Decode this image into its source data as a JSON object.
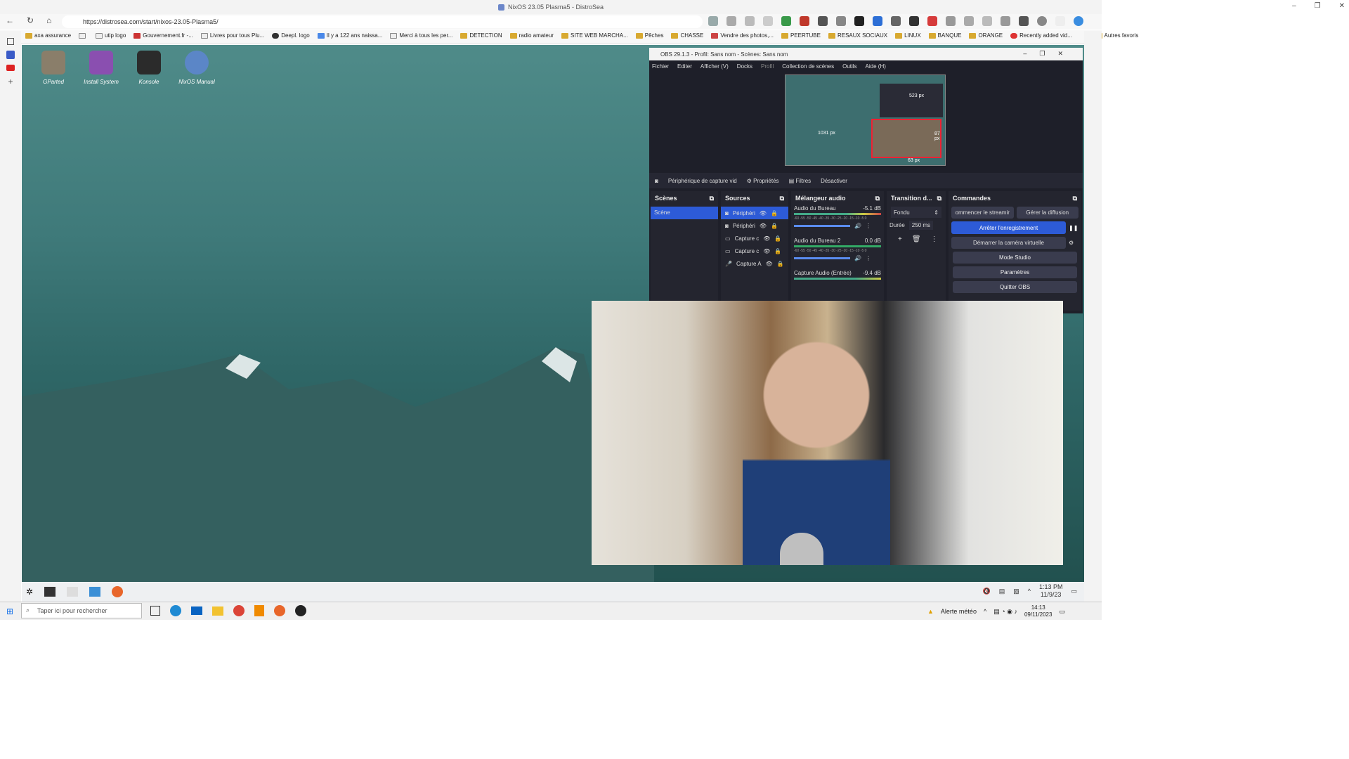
{
  "browser": {
    "window_title": "NixOS 23.05 Plasma5 - DistroSea",
    "url": "https://distrosea.com/start/nixos-23.05-Plasma5/",
    "bookmarks": [
      "axa assurance",
      "",
      "utip logo",
      "Gouvernement.fr -...",
      "Livres pour tous Plu...",
      "Deepl. logo",
      "Il y a 122 ans naissa...",
      "Merci à tous les per...",
      "DETECTION",
      "radio amateur",
      "SITE WEB MARCHA...",
      "Pêches",
      "CHASSE",
      "Vendre des photos,...",
      "PEERTUBE",
      "RESAUX SOCIAUX",
      "LINUX",
      "BANQUE",
      "ORANGE",
      "Recently added vid..."
    ],
    "bookmarks_more": "Autres favoris"
  },
  "desktop": {
    "icons": [
      {
        "label": "GParted",
        "color": "#8a7e6a"
      },
      {
        "label": "Install System",
        "color": "#8a4fb0"
      },
      {
        "label": "Konsole",
        "color": "#2b2b2b"
      },
      {
        "label": "NixOS Manual",
        "color": "#5b86c7"
      }
    ]
  },
  "obs": {
    "title": "OBS 29.1.3 - Profil: Sans nom - Scènes: Sans nom",
    "menu": [
      "Fichier",
      "Editer",
      "Afficher (V)",
      "Docks",
      "Profil",
      "Collection de scènes",
      "Outils",
      "Aide (H)"
    ],
    "preview_labels": [
      "523 px",
      "1031 px",
      "87 px",
      "63 px"
    ],
    "source_bar": {
      "source": "Périphérique de capture vid",
      "properties": "Propriétés",
      "filters": "Filtres",
      "disable": "Désactiver"
    },
    "scenes": {
      "title": "Scènes",
      "items": [
        "Scène"
      ]
    },
    "sources": {
      "title": "Sources",
      "items": [
        "Périphéri",
        "Périphéri",
        "Capture c",
        "Capture c",
        "Capture A"
      ]
    },
    "mixer": {
      "title": "Mélangeur audio",
      "channels": [
        {
          "name": "Audio du Bureau",
          "db": "-5.1 dB"
        },
        {
          "name": "Audio du Bureau 2",
          "db": "0.0 dB"
        },
        {
          "name": "Capture Audio (Entrée)",
          "db": "-9.4 dB"
        }
      ],
      "scale": "-60 -55 -50 -45 -40 -35 -30 -25 -20 -15 -10 -5 0"
    },
    "transition": {
      "title": "Transition d...",
      "type": "Fondu",
      "duration_label": "Durée",
      "duration": "250 ms"
    },
    "commands": {
      "title": "Commandes",
      "start_stream": "ommencer le streamir",
      "manage_stream": "Gérer la diffusion",
      "stop_recording": "Arrêter l'enregistrement",
      "virtual_cam": "Démarrer la caméra virtuelle",
      "studio": "Mode Studio",
      "settings": "Paramètres",
      "quit": "Quitter OBS"
    }
  },
  "kde_taskbar": {
    "time": "1:13 PM",
    "date": "11/9/23"
  },
  "windows_taskbar": {
    "search_placeholder": "Taper ici pour rechercher",
    "weather": "Alerte météo",
    "time": "14:13",
    "date": "09/11/2023"
  }
}
